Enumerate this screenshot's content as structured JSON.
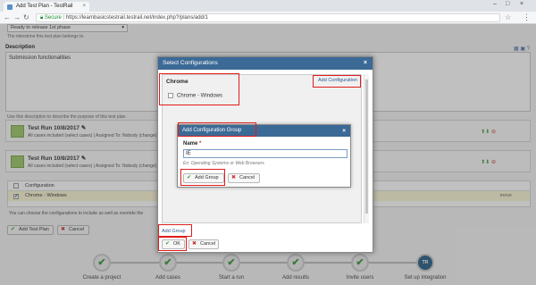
{
  "browser": {
    "tab_title": "Add Test Plan - TestRail",
    "tab_close": "×",
    "secure_label": "Secure",
    "url": "https://learnbasicstestrail.testrail.net/index.php?/plans/add/1",
    "window_controls": [
      "–",
      "□",
      "×"
    ]
  },
  "page": {
    "milestone_value": "Ready to release 1st phase",
    "milestone_hint": "The milestone this test plan belongs to.",
    "description_label": "Description",
    "description_value": "Submission functionalities",
    "description_hint": "Use this description to describe the purpose of this test plan.",
    "runs": [
      {
        "title": "Test Run 10/8/2017 ✎",
        "subtitle": "All cases included (select cases) | Assigned To: Nobody (change)"
      },
      {
        "title": "Test Run 10/8/2017 ✎",
        "subtitle": "All cases included (select cases) | Assigned To: Nobody (change)"
      }
    ],
    "config_header": "Configuration",
    "config_row": "Chrome - Windows",
    "config_suffix": "move",
    "config_note": "You can choose the configurations to include as well as override the",
    "add_test_plan_label": "Add Test Plan",
    "cancel_label": "Cancel"
  },
  "modal": {
    "title": "Select Configurations",
    "close": "×",
    "group_title": "Chrome",
    "add_configuration_label": "Add Configuration",
    "option_label": "Chrome - Windows",
    "add_group_label": "Add Group",
    "ok_label": "OK",
    "cancel_label": "Cancel"
  },
  "dialog": {
    "title": "Add Configuration Group",
    "close": "×",
    "name_label": "Name",
    "required_mark": "*",
    "name_value": "IE",
    "name_hint": "Ex: Operating Systems or Web Browsers",
    "add_group_label": "Add Group",
    "cancel_label": "Cancel"
  },
  "progress": {
    "steps": [
      "Create a project",
      "Add cases",
      "Start a run",
      "Add results",
      "Invite users",
      "Set up integration"
    ],
    "last_step_icon": "TR"
  },
  "colors": {
    "modal_header": "#3c6a96",
    "highlight": "#e01b1b",
    "success": "#3d9a3d"
  }
}
